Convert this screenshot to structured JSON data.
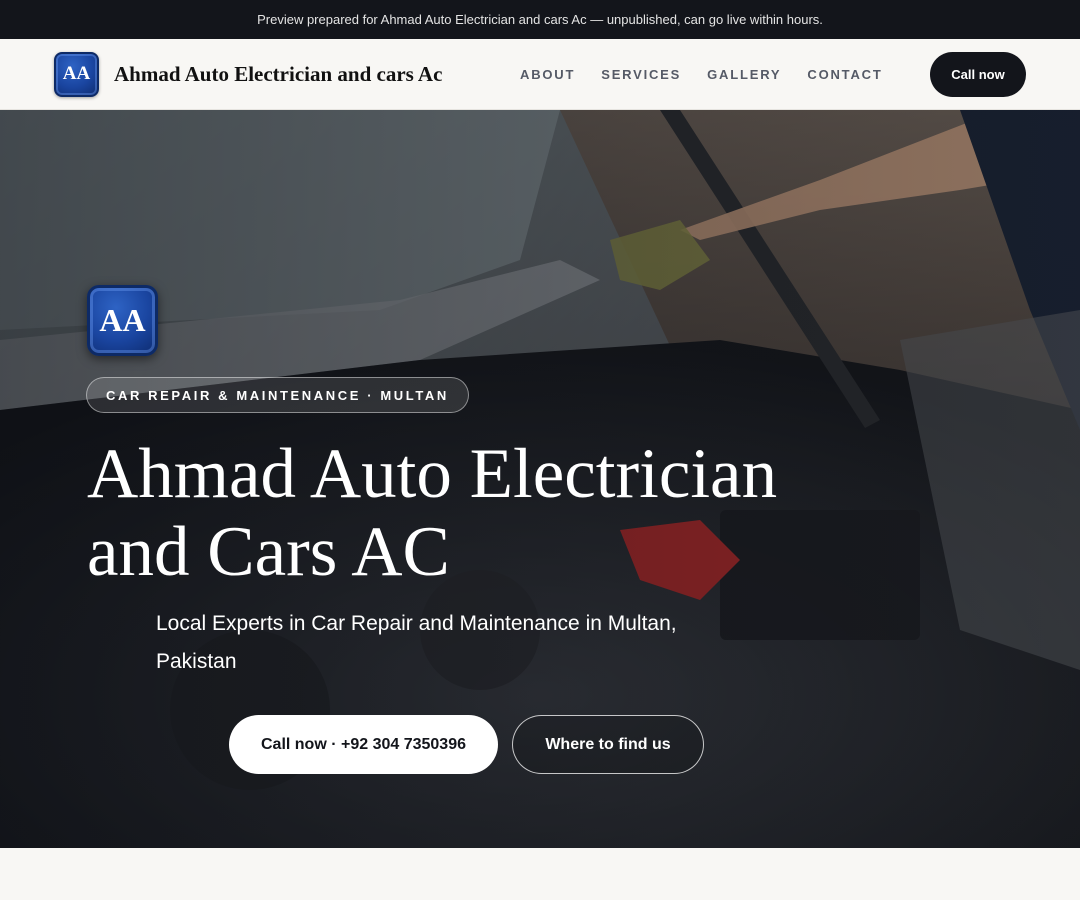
{
  "banner": {
    "text": "Preview prepared for Ahmad Auto Electrician and cars Ac — unpublished, can go live within hours."
  },
  "header": {
    "logo_initials": "AA",
    "brand_name": "Ahmad Auto Electrician and cars Ac",
    "nav": [
      "ABOUT",
      "SERVICES",
      "GALLERY",
      "CONTACT"
    ],
    "call_label": "Call now"
  },
  "hero": {
    "logo_initials": "AA",
    "eyebrow": "CAR REPAIR & MAINTENANCE · MULTAN",
    "title_line1": "Ahmad Auto Electrician",
    "title_line2": "and Cars AC",
    "subtitle": "Local Experts in Car Repair and Maintenance in Multan, Pakistan",
    "primary_cta": "Call now · +92 304 7350396",
    "secondary_cta": "Where to find us",
    "background_image": "car-engine-bay-photo"
  },
  "colors": {
    "dark": "#13151b",
    "brand_blue": "#1a45a0",
    "page_bg": "#f8f7f4"
  }
}
